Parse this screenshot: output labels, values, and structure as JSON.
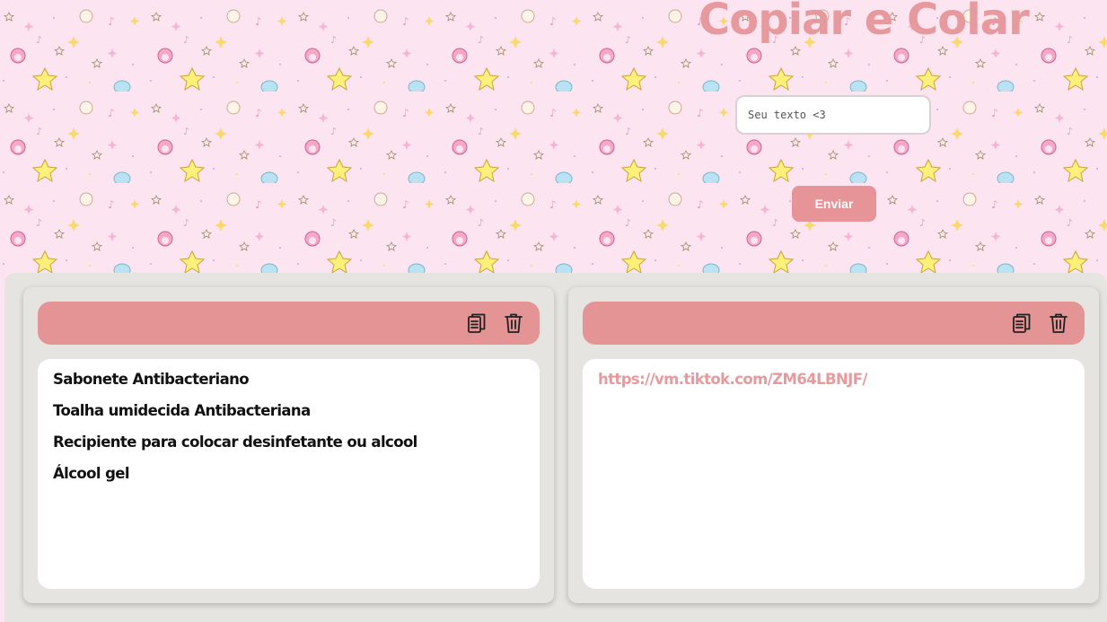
{
  "header": {
    "title": "Copiar e Colar"
  },
  "form": {
    "placeholder": "Seu texto <3",
    "value": "",
    "send_label": "Enviar"
  },
  "cards": [
    {
      "items": [
        "Sabonete Antibacteriano",
        "Toalha umidecida Antibacteriana",
        "Recipiente para colocar desinfetante ou alcool",
        "Álcool gel"
      ],
      "actions": [
        "clipboard-icon",
        "trash-icon"
      ]
    },
    {
      "link": "https://vm.tiktok.com/ZM64LBNJF/",
      "actions": [
        "clipboard-icon",
        "trash-icon"
      ]
    }
  ],
  "colors": {
    "background": "#fde4f1",
    "accent": "#e69497",
    "title": "#e79a9d",
    "panel": "#e6e4e1",
    "link": "#e79a9d"
  }
}
